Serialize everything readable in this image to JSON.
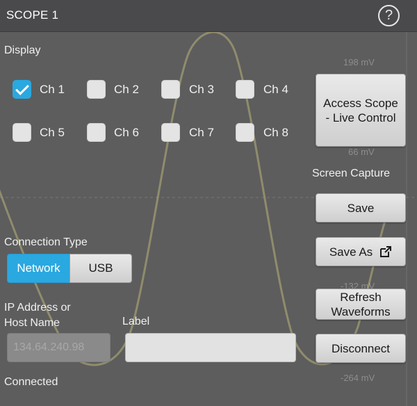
{
  "panel": {
    "title": "SCOPE 1",
    "help_glyph": "?"
  },
  "background_scale": [
    "198 mV",
    "66 mV",
    "-132 mV",
    "-264 mV"
  ],
  "display": {
    "heading": "Display",
    "channels": [
      {
        "label": "Ch 1",
        "checked": true
      },
      {
        "label": "Ch 2",
        "checked": false
      },
      {
        "label": "Ch 3",
        "checked": false
      },
      {
        "label": "Ch 4",
        "checked": false
      },
      {
        "label": "Ch 5",
        "checked": false
      },
      {
        "label": "Ch 6",
        "checked": false
      },
      {
        "label": "Ch 7",
        "checked": false
      },
      {
        "label": "Ch 8",
        "checked": false
      }
    ]
  },
  "access_button": {
    "line1": "Access Scope",
    "line2": "- Live Control"
  },
  "screen_capture": {
    "heading": "Screen Capture",
    "save_label": "Save",
    "save_as_label": "Save As",
    "save_as_icon": "external-link-icon"
  },
  "refresh_button": {
    "line1": "Refresh",
    "line2": "Waveforms"
  },
  "disconnect_label": "Disconnect",
  "connection": {
    "heading": "Connection Type",
    "options": [
      "Network",
      "USB"
    ],
    "selected": "Network"
  },
  "ip": {
    "label_line1": "IP Address or",
    "label_line2": "Host Name",
    "value": "134.64.240.98"
  },
  "label_field": {
    "label": "Label",
    "value": ""
  },
  "status": "Connected",
  "colors": {
    "accent": "#2aa8e0",
    "waveform": "#b9b37a",
    "panel_bg": "#5d5d5d",
    "titlebar_bg": "#4a4a4c"
  }
}
